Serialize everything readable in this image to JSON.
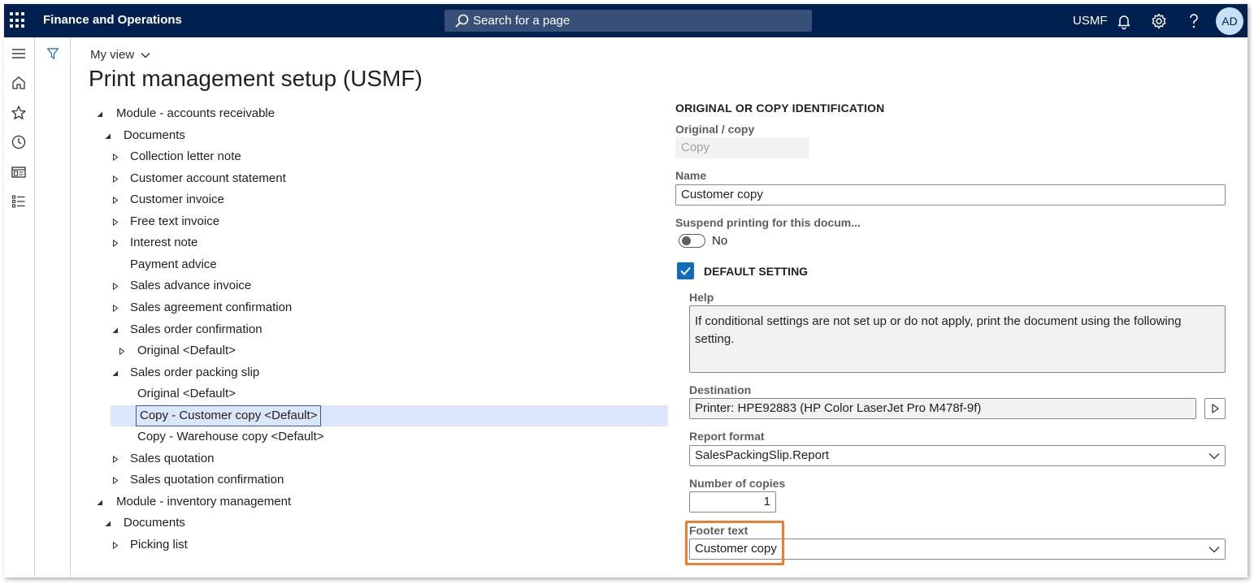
{
  "topbar": {
    "app_title": "Finance and Operations",
    "search_placeholder": "Search for a page",
    "company": "USMF",
    "avatar_initials": "AD",
    "icons": [
      "app-launcher-icon",
      "search-icon",
      "bell-icon",
      "gear-icon",
      "help-icon"
    ]
  },
  "leftnav": {
    "icons": [
      "hamburger-icon",
      "home-icon",
      "star-icon",
      "clock-icon",
      "workspace-icon",
      "modules-list-icon"
    ]
  },
  "header": {
    "my_view": "My view",
    "page_title": "Print management setup (USMF)"
  },
  "tree": [
    {
      "label": "Module - accounts receivable",
      "level": 0,
      "expander": "expanded"
    },
    {
      "label": "Documents",
      "level": 1,
      "expander": "expanded"
    },
    {
      "label": "Collection letter note",
      "level": 2,
      "expander": "collapsed"
    },
    {
      "label": "Customer account statement",
      "level": 2,
      "expander": "collapsed"
    },
    {
      "label": "Customer invoice",
      "level": 2,
      "expander": "collapsed"
    },
    {
      "label": "Free text invoice",
      "level": 2,
      "expander": "collapsed"
    },
    {
      "label": "Interest note",
      "level": 2,
      "expander": "collapsed"
    },
    {
      "label": "Payment advice",
      "level": 2,
      "expander": "none"
    },
    {
      "label": "Sales advance invoice",
      "level": 2,
      "expander": "collapsed"
    },
    {
      "label": "Sales agreement confirmation",
      "level": 2,
      "expander": "collapsed"
    },
    {
      "label": "Sales order confirmation",
      "level": 2,
      "expander": "expanded"
    },
    {
      "label": "Original <Default>",
      "level": 3,
      "expander": "collapsed"
    },
    {
      "label": "Sales order packing slip",
      "level": 2,
      "expander": "expanded"
    },
    {
      "label": "Original <Default>",
      "level": 3,
      "expander": "none"
    },
    {
      "label": "Copy - Customer copy <Default>",
      "level": 3,
      "expander": "none",
      "selected": true
    },
    {
      "label": "Copy - Warehouse copy <Default>",
      "level": 3,
      "expander": "none"
    },
    {
      "label": "Sales quotation",
      "level": 2,
      "expander": "collapsed"
    },
    {
      "label": "Sales quotation confirmation",
      "level": 2,
      "expander": "collapsed"
    },
    {
      "label": "Module - inventory management",
      "level": 0,
      "expander": "expanded"
    },
    {
      "label": "Documents",
      "level": 1,
      "expander": "expanded"
    },
    {
      "label": "Picking list",
      "level": 2,
      "expander": "collapsed"
    }
  ],
  "form": {
    "section_title": "ORIGINAL OR COPY IDENTIFICATION",
    "original_copy": {
      "label": "Original / copy",
      "value": "Copy"
    },
    "name": {
      "label": "Name",
      "value": "Customer copy"
    },
    "suspend": {
      "label": "Suspend printing for this docum...",
      "value": "No",
      "on": false
    },
    "default_setting": {
      "label": "DEFAULT SETTING",
      "checked": true
    },
    "help": {
      "label": "Help",
      "text": "If conditional settings are not set up or do not apply, print the document using the following setting."
    },
    "destination": {
      "label": "Destination",
      "value": "Printer: HPE92883 (HP Color LaserJet Pro M478f-9f)"
    },
    "report_format": {
      "label": "Report format",
      "value": "SalesPackingSlip.Report"
    },
    "number_of_copies": {
      "label": "Number of copies",
      "value": "1"
    },
    "footer_text": {
      "label": "Footer text",
      "value": "Customer copy"
    }
  },
  "colors": {
    "topbar": "#002050",
    "selection": "#dbe6fb",
    "accent": "#0f6cbd",
    "highlight": "#ed7d31"
  }
}
